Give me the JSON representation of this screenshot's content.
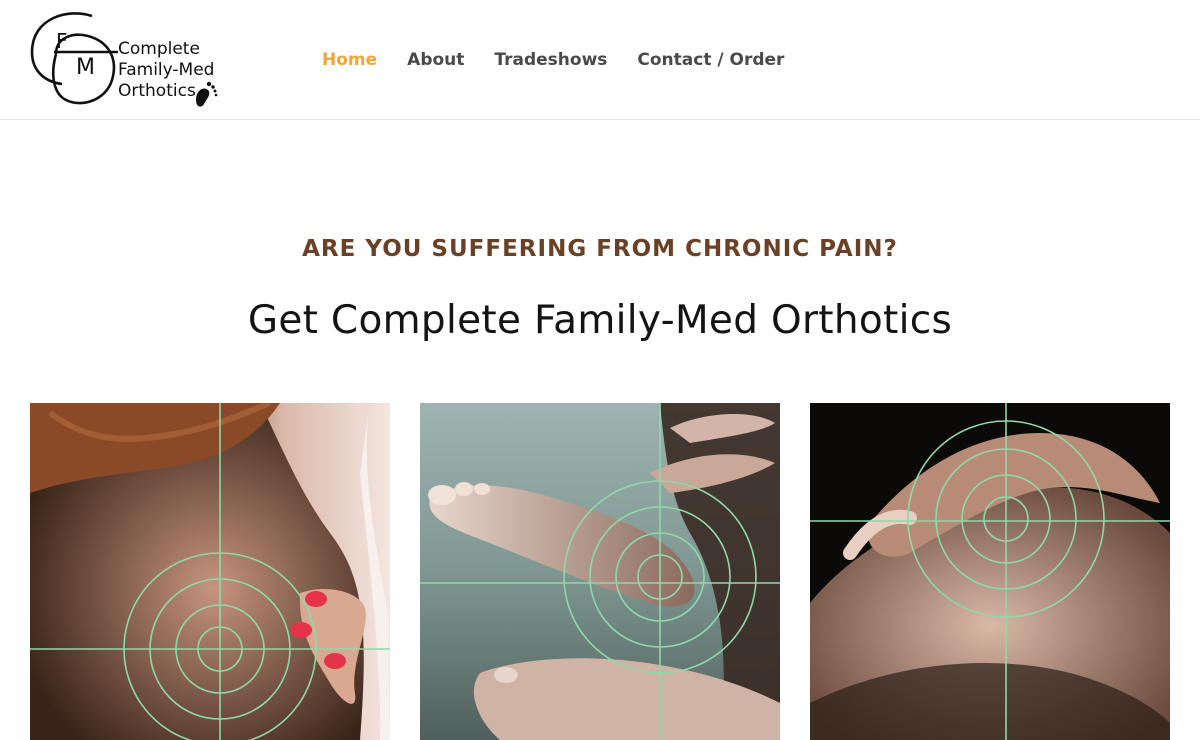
{
  "brand": {
    "logo_lines": [
      "Complete",
      "Family-Med",
      "Orthotics"
    ],
    "logo_monogram": "CFM",
    "logo_icon": "footprint-icon"
  },
  "nav": {
    "items": [
      {
        "label": "Home",
        "active": true
      },
      {
        "label": "About",
        "active": false
      },
      {
        "label": "Tradeshows",
        "active": false
      },
      {
        "label": "Contact / Order",
        "active": false
      }
    ],
    "active_color": "#f0a535",
    "text_color": "#4a4a4a"
  },
  "hero": {
    "kicker": "ARE YOU SUFFERING FROM CHRONIC PAIN?",
    "title": "Get Complete Family-Med Orthotics",
    "kicker_color": "#6a4127"
  },
  "tiles": [
    {
      "subject": "neck-and-shoulder",
      "target_icon": "target-crosshair-icon"
    },
    {
      "subject": "foot-and-ankle",
      "target_icon": "target-crosshair-icon"
    },
    {
      "subject": "knee",
      "target_icon": "target-crosshair-icon"
    }
  ],
  "colors": {
    "target_rings": "#8fd8a8"
  }
}
